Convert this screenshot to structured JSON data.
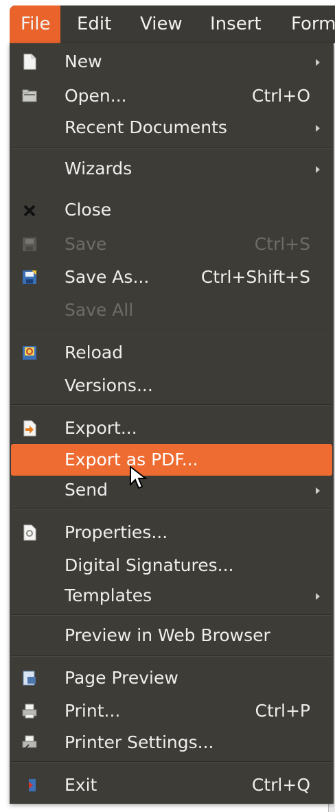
{
  "menubar": {
    "items": [
      {
        "label": "File",
        "active": true
      },
      {
        "label": "Edit"
      },
      {
        "label": "View"
      },
      {
        "label": "Insert"
      },
      {
        "label": "Form"
      }
    ]
  },
  "menu": {
    "items": {
      "new": {
        "label": "New",
        "submenu": true,
        "icon": "new-document-icon"
      },
      "open": {
        "label": "Open...",
        "shortcut": "Ctrl+O",
        "icon": "folder-open-icon"
      },
      "recent": {
        "label": "Recent Documents",
        "submenu": true
      },
      "wizards": {
        "label": "Wizards",
        "submenu": true
      },
      "close": {
        "label": "Close",
        "icon": "close-icon"
      },
      "save": {
        "label": "Save",
        "shortcut": "Ctrl+S",
        "disabled": true,
        "icon": "save-icon"
      },
      "saveas": {
        "label": "Save As...",
        "shortcut": "Ctrl+Shift+S",
        "icon": "save-as-icon"
      },
      "saveall": {
        "label": "Save All",
        "disabled": true
      },
      "reload": {
        "label": "Reload",
        "icon": "reload-icon"
      },
      "versions": {
        "label": "Versions..."
      },
      "export": {
        "label": "Export...",
        "icon": "export-icon"
      },
      "exportpdf": {
        "label": "Export as PDF...",
        "highlighted": true
      },
      "send": {
        "label": "Send",
        "submenu": true
      },
      "properties": {
        "label": "Properties...",
        "icon": "properties-icon"
      },
      "digsig": {
        "label": "Digital Signatures..."
      },
      "templates": {
        "label": "Templates",
        "submenu": true
      },
      "preview": {
        "label": "Preview in Web Browser"
      },
      "pageprev": {
        "label": "Page Preview",
        "icon": "page-preview-icon"
      },
      "print": {
        "label": "Print...",
        "shortcut": "Ctrl+P",
        "icon": "printer-icon"
      },
      "printset": {
        "label": "Printer Settings...",
        "icon": "printer-settings-icon"
      },
      "exit": {
        "label": "Exit",
        "shortcut": "Ctrl+Q",
        "icon": "exit-icon"
      }
    }
  },
  "colors": {
    "menu_bg": "#3d3c37",
    "accent": "#ee6b31",
    "text": "#efeeec",
    "disabled_text": "#6e6c66"
  }
}
